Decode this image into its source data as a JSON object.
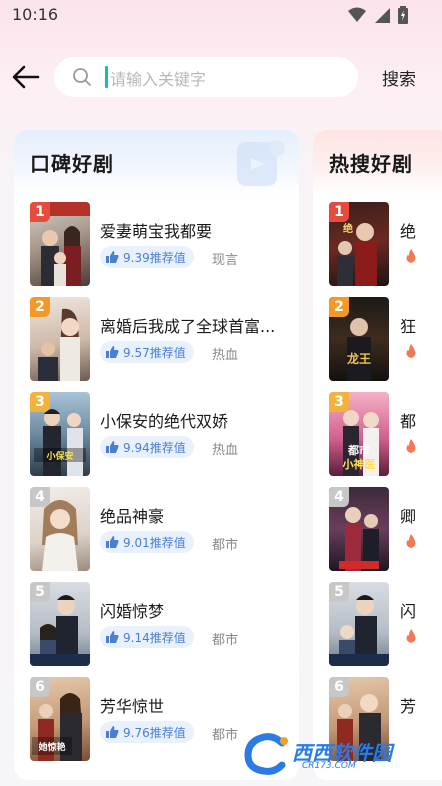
{
  "status_bar": {
    "time": "10:16",
    "icons": [
      "wifi-icon",
      "signal-icon",
      "battery-charging-icon"
    ]
  },
  "search": {
    "placeholder": "请输入关键字",
    "button": "搜索"
  },
  "colors": {
    "rank_1": "#e64b3b",
    "rank_2": "#f29a25",
    "rank_3": "#f4b23a",
    "rank_other": "#c7c7c7",
    "score_text": "#4a7fd0",
    "fire": "#f07a55",
    "cursor": "#12bfb0"
  },
  "sections": [
    {
      "title": "口碑好剧",
      "items": [
        {
          "rank": "1",
          "title": "爱妻萌宝我都要",
          "score": "9.39推荐值",
          "genre": "现言",
          "poster_text": "爱妻萌宝我都要"
        },
        {
          "rank": "2",
          "title": "离婚后我成了全球首富...",
          "score": "9.57推荐值",
          "genre": "热血",
          "poster_text": ""
        },
        {
          "rank": "3",
          "title": "小保安的绝代双娇",
          "score": "9.94推荐值",
          "genre": "热血",
          "poster_text": "小保安的绝代双娇"
        },
        {
          "rank": "4",
          "title": "绝品神豪",
          "score": "9.01推荐值",
          "genre": "都市",
          "poster_text": ""
        },
        {
          "rank": "5",
          "title": "闪婚惊梦",
          "score": "9.14推荐值",
          "genre": "都市",
          "poster_text": ""
        },
        {
          "rank": "6",
          "title": "芳华惊世",
          "score": "9.76推荐值",
          "genre": "都市",
          "poster_text": "她惊艳了世界"
        }
      ]
    },
    {
      "title": "热搜好剧",
      "items": [
        {
          "rank": "1",
          "title": "绝"
        },
        {
          "rank": "2",
          "title": "狂"
        },
        {
          "rank": "3",
          "title": "都",
          "poster_text": "都市小神医"
        },
        {
          "rank": "4",
          "title": "卿"
        },
        {
          "rank": "5",
          "title": "闪"
        },
        {
          "rank": "6",
          "title": "芳"
        }
      ]
    }
  ],
  "watermark": {
    "name": "西西软件园",
    "url": "CR173.COM"
  }
}
